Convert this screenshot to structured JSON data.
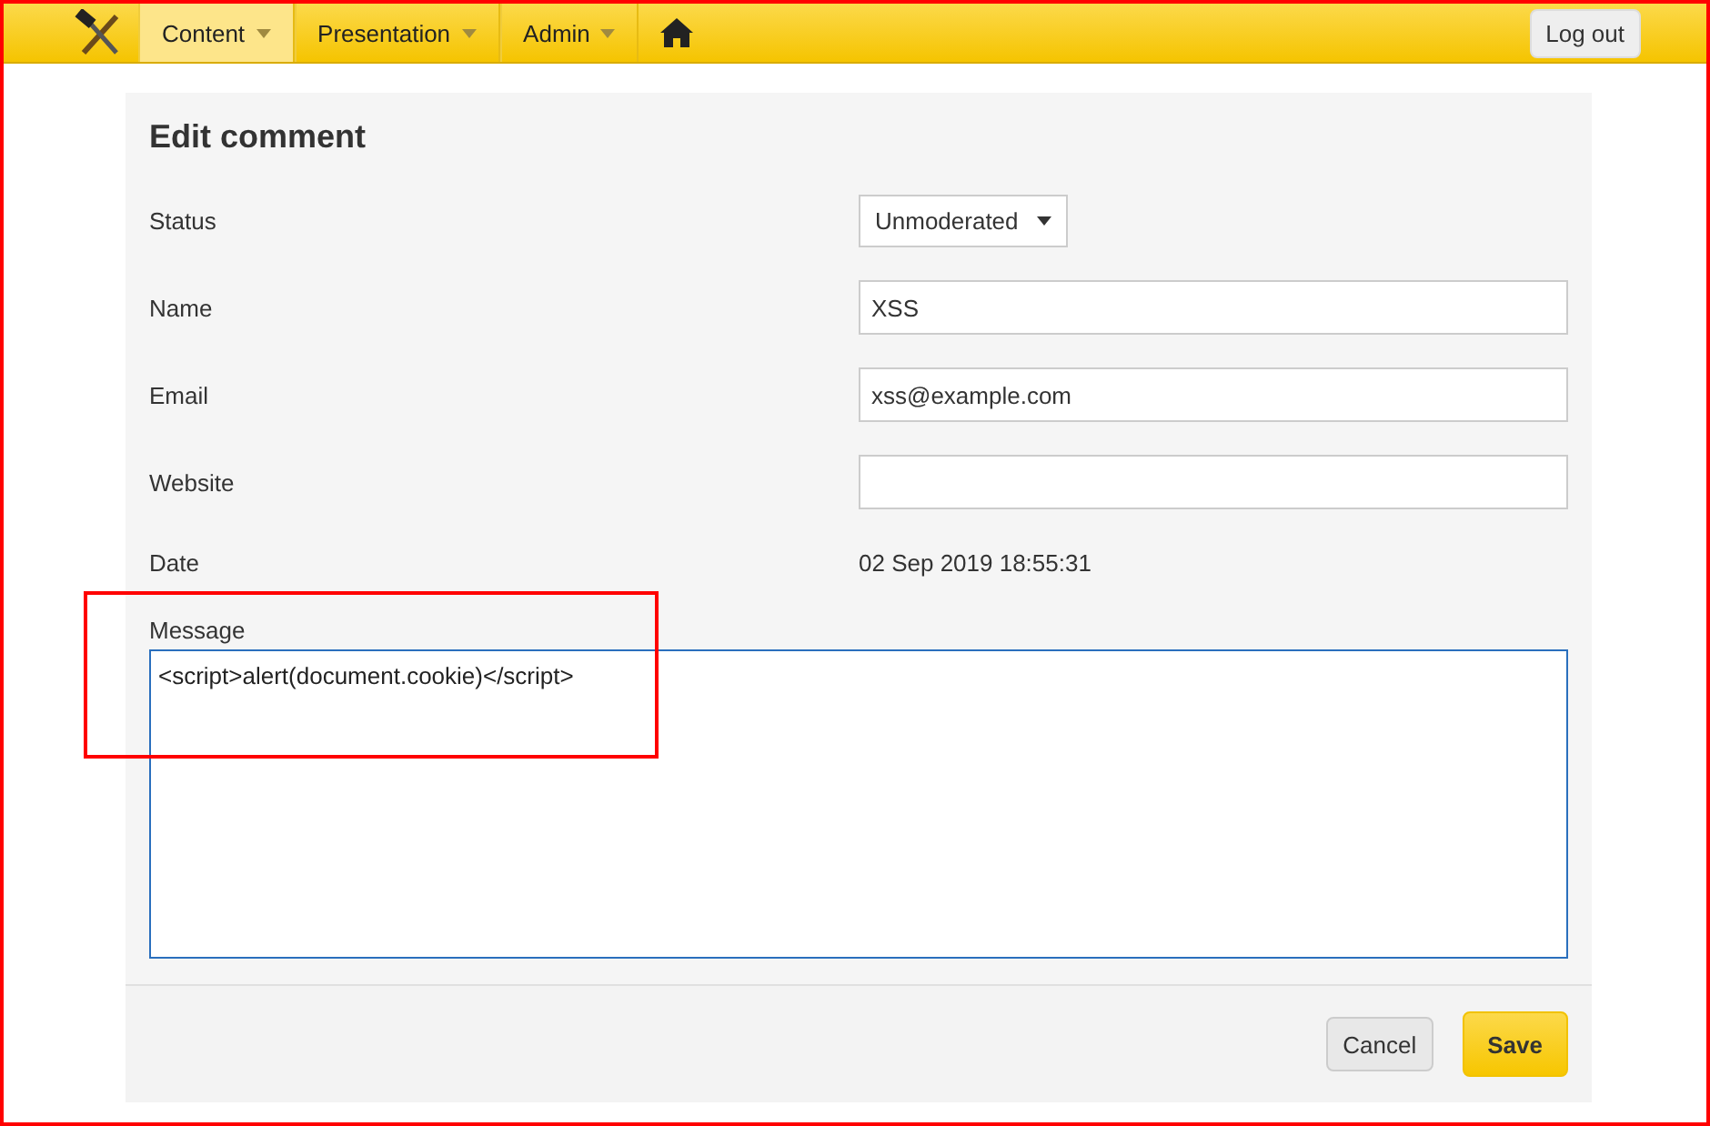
{
  "navbar": {
    "menus": [
      {
        "label": "Content",
        "selected": true
      },
      {
        "label": "Presentation",
        "selected": false
      },
      {
        "label": "Admin",
        "selected": false
      }
    ],
    "logout": "Log out"
  },
  "form": {
    "title": "Edit comment",
    "fields": [
      {
        "kind": "select",
        "label": "Status",
        "value": "Unmoderated"
      },
      {
        "kind": "text",
        "label": "Name",
        "value": "XSS"
      },
      {
        "kind": "text",
        "label": "Email",
        "value": "xss@example.com"
      },
      {
        "kind": "text",
        "label": "Website"
      },
      {
        "kind": "static",
        "label": "Date",
        "value": "02 Sep 2019 18:55:31"
      },
      {
        "kind": "textarea",
        "label": "Message",
        "value": "<script>alert(document.cookie)</script>",
        "focused": true
      }
    ],
    "buttons": [
      {
        "kind": "secondary",
        "label": "Cancel"
      },
      {
        "kind": "primary",
        "label": "Save"
      }
    ]
  },
  "annotation": {
    "highlight": true
  }
}
